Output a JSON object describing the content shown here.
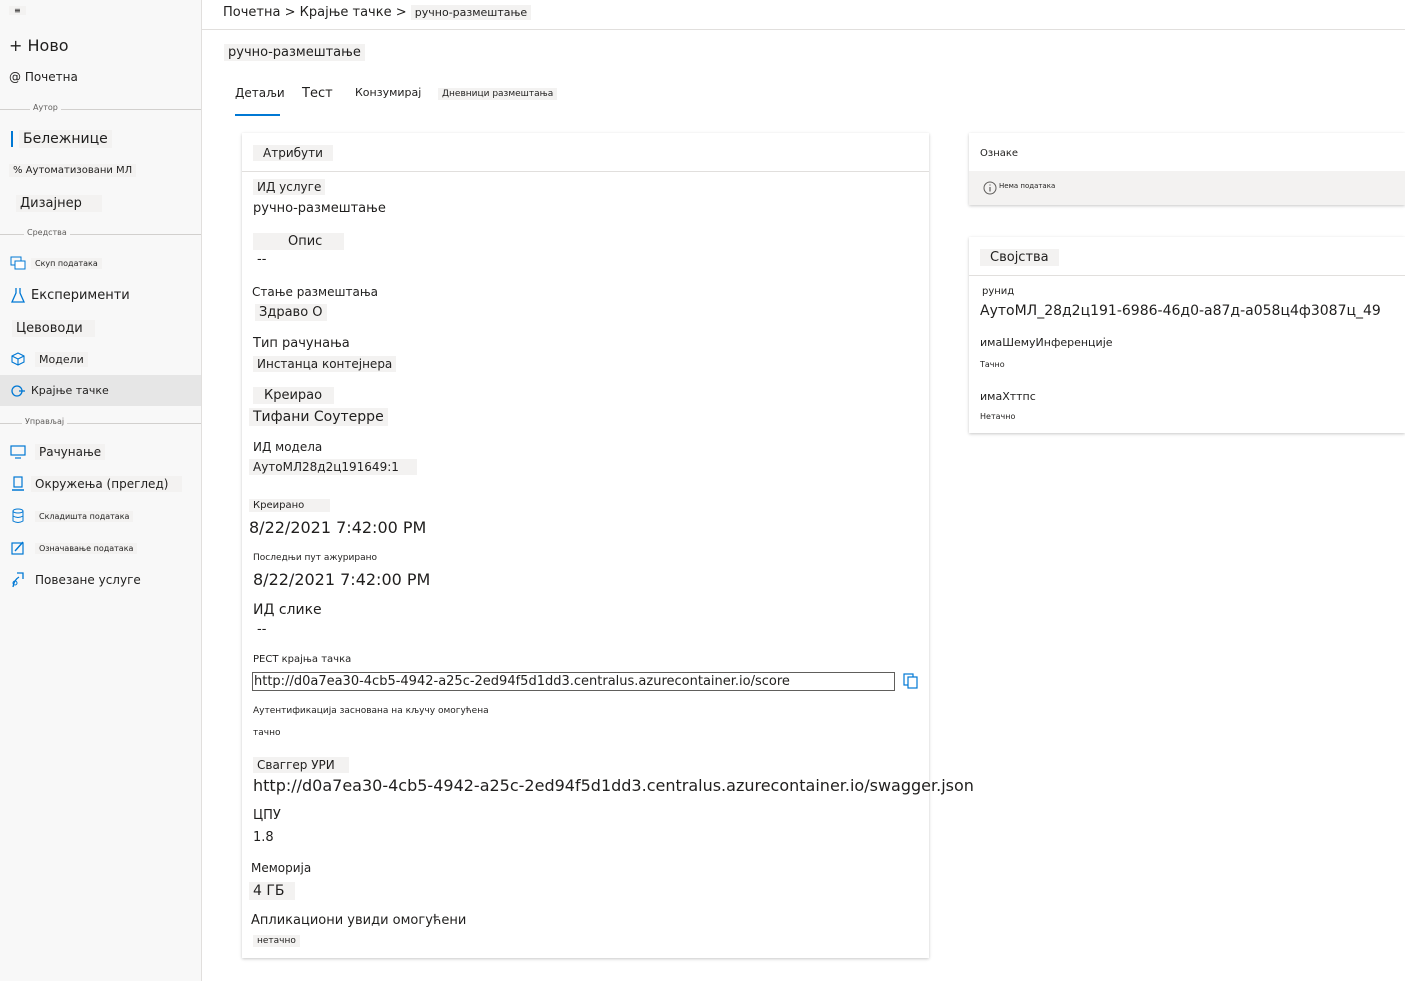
{
  "sidebar": {
    "hamburger": "≡",
    "new_label": "+ Ново",
    "home_label": "@ Почетна",
    "author_section": "Аутор",
    "notebooks": "Бележнице",
    "automl": "% Аутоматизовани МЛ",
    "designer": "Дизајнер",
    "assets_section": "Средства",
    "datasets": "Скуп података",
    "experiments": "Експерименти",
    "pipelines": "Цевоводи",
    "models": "Модели",
    "endpoints": "Крајње тачке",
    "manage_section": "Управљај",
    "compute": "Рачунање",
    "environments": "Окружења (преглед)",
    "datastores": "Складишта података",
    "labeling": "Означавање података",
    "linked_services": "Повезане услуге"
  },
  "breadcrumb": {
    "home": "Почетна",
    "sep": ">",
    "endpoints": "Крајње тачке",
    "current": "ручно-размештање"
  },
  "page_title": "ручно-размештање",
  "tabs": {
    "details": "Детаљи",
    "test": "Тест",
    "consume": "Конзумирај",
    "logs": "Дневници размештања"
  },
  "attributes": {
    "header": "Атрибути",
    "service_id_label": "ИД услуге",
    "service_id": "ручно-размештање",
    "description_label": "Опис",
    "description": "--",
    "state_label": "Стање размештања",
    "state": "Здраво О",
    "compute_type_label": "Тип рачунања",
    "compute_type": "Инстанца контејнера",
    "created_by_label": "Креирао",
    "created_by": "Тифани Соутерре",
    "model_id_label": "ИД модела",
    "model_id": "АутоМЛ28д2ц191649:1",
    "created_label": "Креирано",
    "created": "8/22/2021 7:42:00 PM",
    "updated_label": "Последњи пут ажурирано",
    "updated": "8/22/2021 7:42:00 PM",
    "image_id_label": "ИД слике",
    "image_id": "--",
    "rest_label": "РЕСТ крајња тачка",
    "rest": "http://d0a7ea30-4cb5-4942-a25c-2ed94f5d1dd3.centralus.azurecontainer.io/score",
    "auth_label": "Аутентификација заснована на кључу омогућена",
    "auth": "тачно",
    "swagger_label": "Сваггер УРИ",
    "swagger": "http://d0a7ea30-4cb5-4942-a25c-2ed94f5d1dd3.centralus.azurecontainer.io/swagger.json",
    "cpu_label": "ЦПУ",
    "cpu": "1.8",
    "memory_label": "Меморија",
    "memory": "4 ГБ",
    "insights_label": "Апликациони увиди омогућени",
    "insights": "нетачно"
  },
  "tags": {
    "header": "Ознаке",
    "empty": "Нема података"
  },
  "properties": {
    "header": "Својства",
    "runid_label": "рунид",
    "runid": "АутоМЛ_28д2ц191-6986-46д0-а87д-а058ц4ф3087ц_49",
    "schema_label": "имаШемуИнференције",
    "schema": "Тачно",
    "https_label": "имаХттпс",
    "https": "Нетачно"
  },
  "colors": {
    "accent": "#0078d4",
    "sidebar_bg": "#f8f8f8",
    "active_bg": "#e6e6e6"
  },
  "icons": [
    "hamburger-icon",
    "notebook-icon",
    "dataset-icon",
    "experiment-icon",
    "model-icon",
    "endpoint-icon",
    "compute-icon",
    "environment-icon",
    "datastore-icon",
    "labeling-icon",
    "linked-service-icon",
    "info-icon",
    "copy-icon"
  ]
}
